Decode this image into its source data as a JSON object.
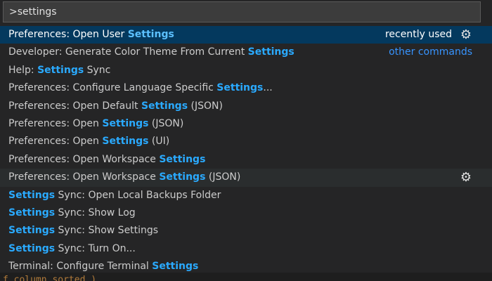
{
  "input": {
    "value": ">settings"
  },
  "items": [
    {
      "pre": "Preferences: Open User ",
      "hl": "Settings",
      "post": "",
      "right": "recently used"
    },
    {
      "pre": "Developer: Generate Color Theme From Current ",
      "hl": "Settings",
      "post": "",
      "right": "other commands"
    },
    {
      "pre": "Help: ",
      "hl": "Settings",
      "post": " Sync"
    },
    {
      "pre": "Preferences: Configure Language Specific ",
      "hl": "Settings",
      "post": "..."
    },
    {
      "pre": "Preferences: Open Default ",
      "hl": "Settings",
      "post": " (JSON)"
    },
    {
      "pre": "Preferences: Open ",
      "hl": "Settings",
      "post": " (JSON)"
    },
    {
      "pre": "Preferences: Open ",
      "hl": "Settings",
      "post": " (UI)"
    },
    {
      "pre": "Preferences: Open Workspace ",
      "hl": "Settings",
      "post": ""
    },
    {
      "pre": "Preferences: Open Workspace ",
      "hl": "Settings",
      "post": " (JSON)"
    },
    {
      "pre": "",
      "hl": "Settings",
      "post": " Sync: Open Local Backups Folder"
    },
    {
      "pre": "",
      "hl": "Settings",
      "post": " Sync: Show Log"
    },
    {
      "pre": "",
      "hl": "Settings",
      "post": " Sync: Show Settings"
    },
    {
      "pre": "",
      "hl": "Settings",
      "post": " Sync: Turn On..."
    },
    {
      "pre": "Terminal: Configure Terminal ",
      "hl": "Settings",
      "post": ""
    }
  ],
  "editor_peek": {
    "text": "f column_sorted )"
  },
  "icons": {
    "gear": "gear-icon"
  },
  "colors": {
    "highlight": "#2aaaff",
    "selected_bg": "#04395e",
    "link": "#3794ff"
  }
}
